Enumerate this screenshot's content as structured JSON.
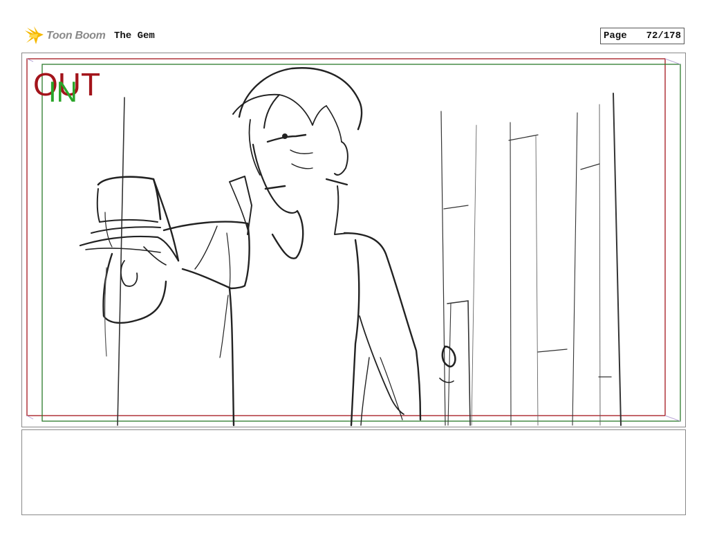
{
  "header": {
    "logo_text": "Toon Boom",
    "project_title": "The Gem",
    "page_label": "Page",
    "page_number": "72/178"
  },
  "panel": {
    "out_label": "OUT",
    "in_label": "IN",
    "out_frame_color": "#a3141b",
    "in_frame_color": "#2a7a2a",
    "image": "sketch of a young man aiming a pistol at the viewer, standing among vertical bars"
  },
  "notes": {
    "text": ""
  }
}
